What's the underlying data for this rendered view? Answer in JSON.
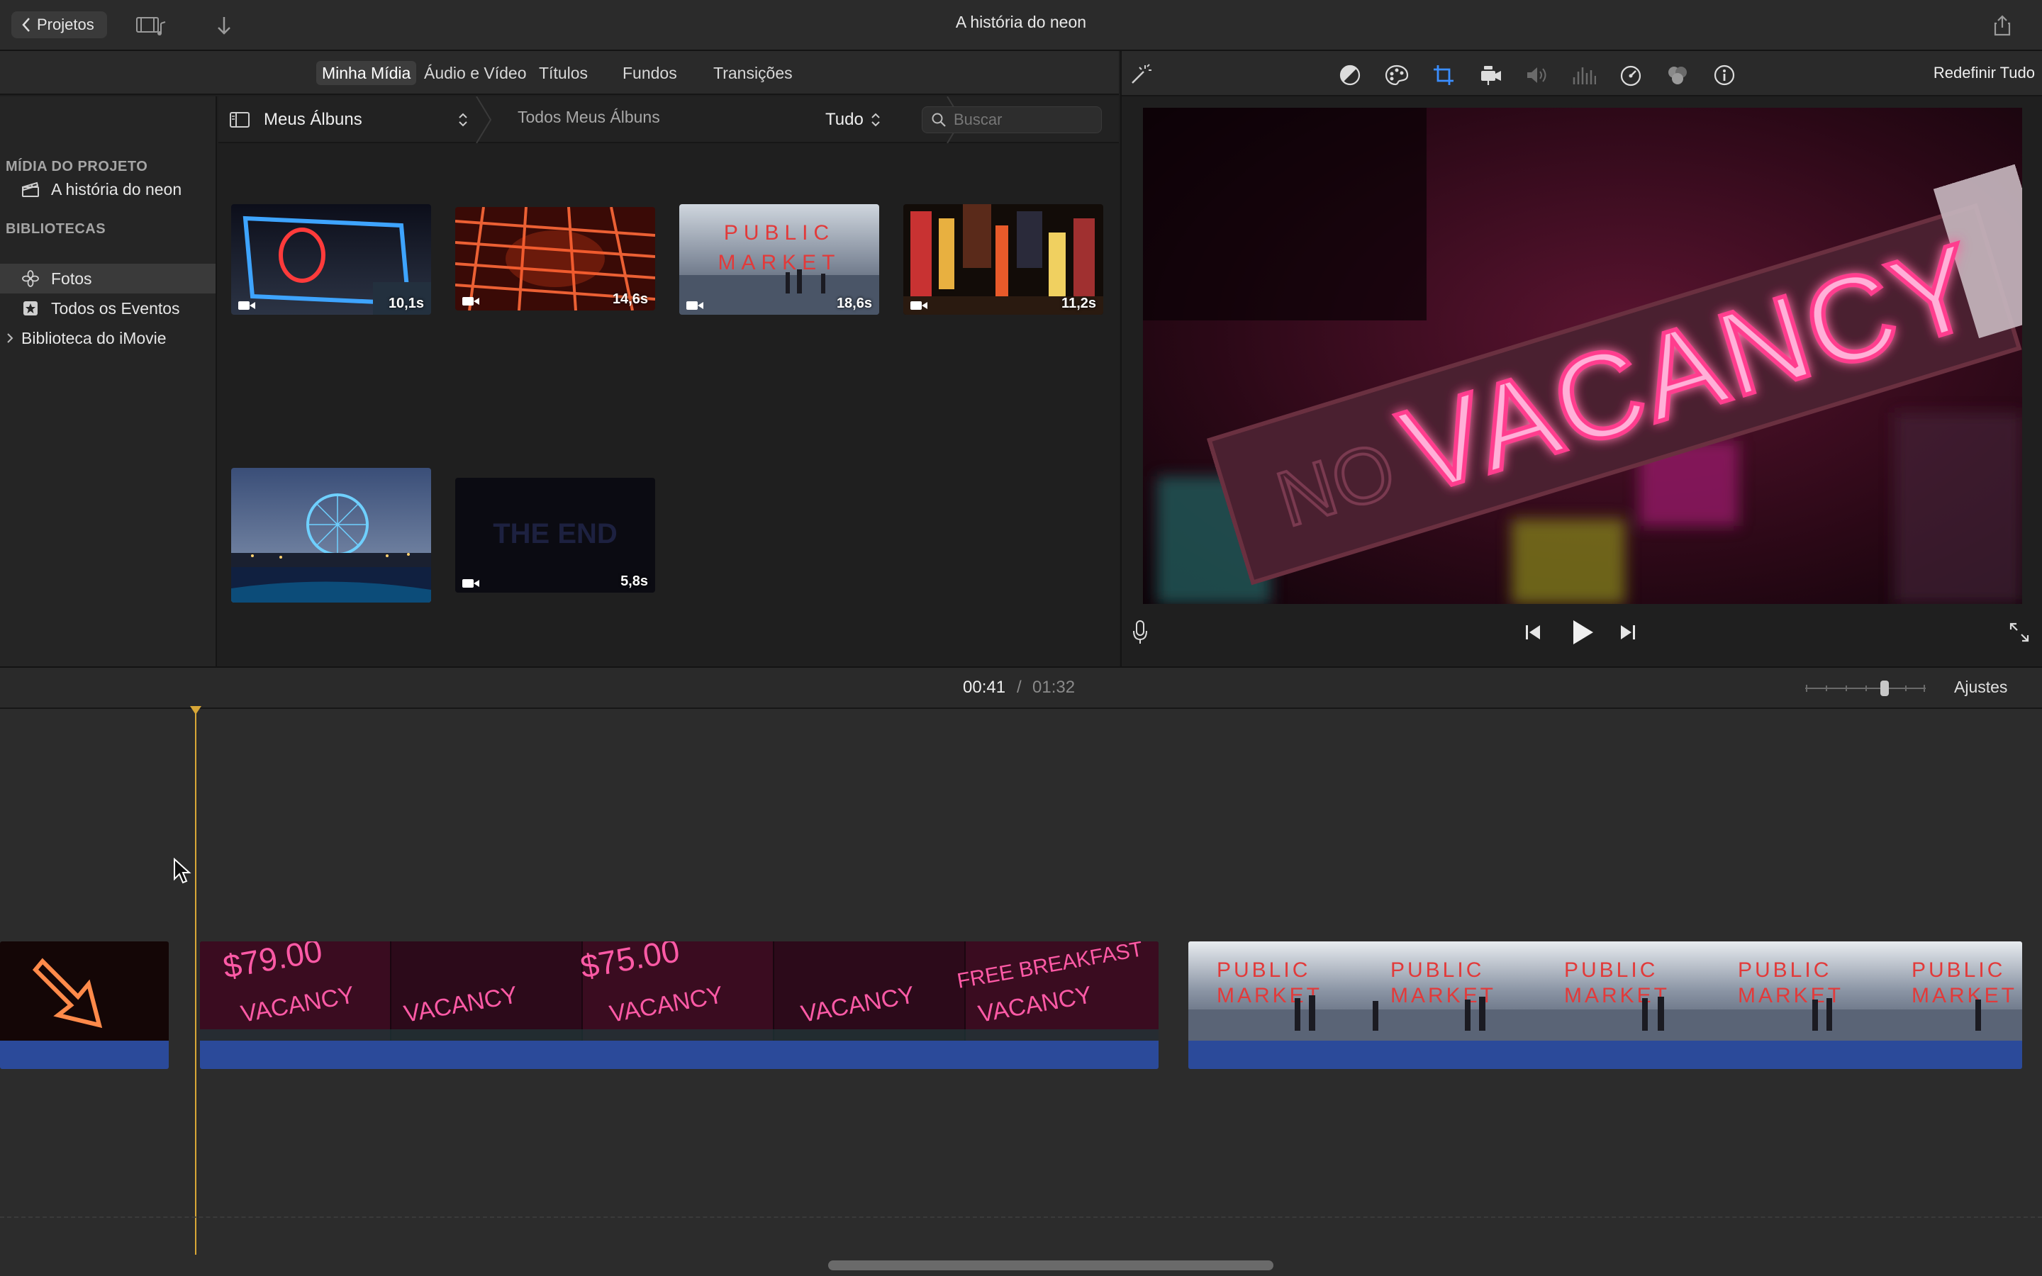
{
  "titlebar": {
    "back_label": "Projetos",
    "title": "A história do neon",
    "icons": [
      "film-music-icon",
      "download-arrow-icon",
      "share-icon"
    ]
  },
  "media_tabs": [
    "Minha Mídia",
    "Áudio e Vídeo",
    "Títulos",
    "Fundos",
    "Transições"
  ],
  "media_tabs_active": "Minha Mídia",
  "sidebar": {
    "project_header": "MÍDIA DO PROJETO",
    "project_item": "A história do neon",
    "libraries_header": "BIBLIOTECAS",
    "items": [
      "Fotos",
      "Todos os Eventos",
      "Biblioteca do iMovie"
    ],
    "selected": "Fotos"
  },
  "browser": {
    "album": "Meus Álbuns",
    "breadcrumb": "Todos Meus Álbuns",
    "filter": "Tudo",
    "search_placeholder": "Buscar",
    "clips": [
      {
        "duration": "10,1s",
        "theme": "neon-circle-blue"
      },
      {
        "duration": "14,6s",
        "theme": "neon-red-ceiling"
      },
      {
        "duration": "18,6s",
        "theme": "public-market"
      },
      {
        "duration": "11,2s",
        "theme": "city-night"
      },
      {
        "duration": "",
        "theme": "ferris-wheel"
      },
      {
        "duration": "5,8s",
        "theme": "the-end"
      }
    ],
    "public_market_text": [
      "PUBLIC",
      "MARKET"
    ],
    "the_end_text": "THE END"
  },
  "viewer": {
    "reset_label": "Redefinir Tudo",
    "sign_text": "VACANCY",
    "sign_prefix": "NO",
    "tools": [
      "magic-wand-icon",
      "color-balance-icon",
      "color-correction-icon",
      "crop-icon",
      "stabilization-icon",
      "volume-icon",
      "noise-reduction-icon",
      "speed-icon",
      "clip-filter-icon",
      "info-icon"
    ]
  },
  "timeline": {
    "current": "00:41",
    "separator": "/",
    "total": "01:32",
    "settings_label": "Ajustes",
    "vacancy_texts": [
      "$79.00",
      "VACANCY",
      "$75.00",
      "VACANCY",
      "FREE BREAKFAST",
      "VACANCY"
    ],
    "market_text": [
      "PUBLIC",
      "MARKET"
    ]
  },
  "colors": {
    "accent_blue": "#2b4a9a",
    "playhead": "#d8a737",
    "neon_pink": "#ff3c8e"
  }
}
